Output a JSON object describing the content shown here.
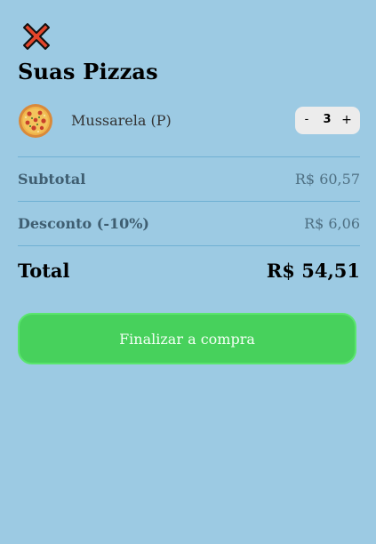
{
  "header": {
    "close_icon": "close-x-icon",
    "title": "Suas Pizzas"
  },
  "cart": {
    "items": [
      {
        "image_icon": "pizza-icon",
        "name": "Mussarela (P)",
        "quantity": "3",
        "decrement_label": "-",
        "increment_label": "+"
      }
    ]
  },
  "summary": {
    "subtotal_label": "Subtotal",
    "subtotal_value": "R$ 60,57",
    "discount_label": "Desconto (-10%)",
    "discount_value": "R$ 6,06",
    "total_label": "Total",
    "total_value": "R$ 54,51"
  },
  "checkout": {
    "button_label": "Finalizar a compra"
  },
  "colors": {
    "background": "#9ccae3",
    "checkout_button": "#47d15c",
    "close_icon_fill": "#e4452b",
    "divider": "#6fb0d3"
  }
}
